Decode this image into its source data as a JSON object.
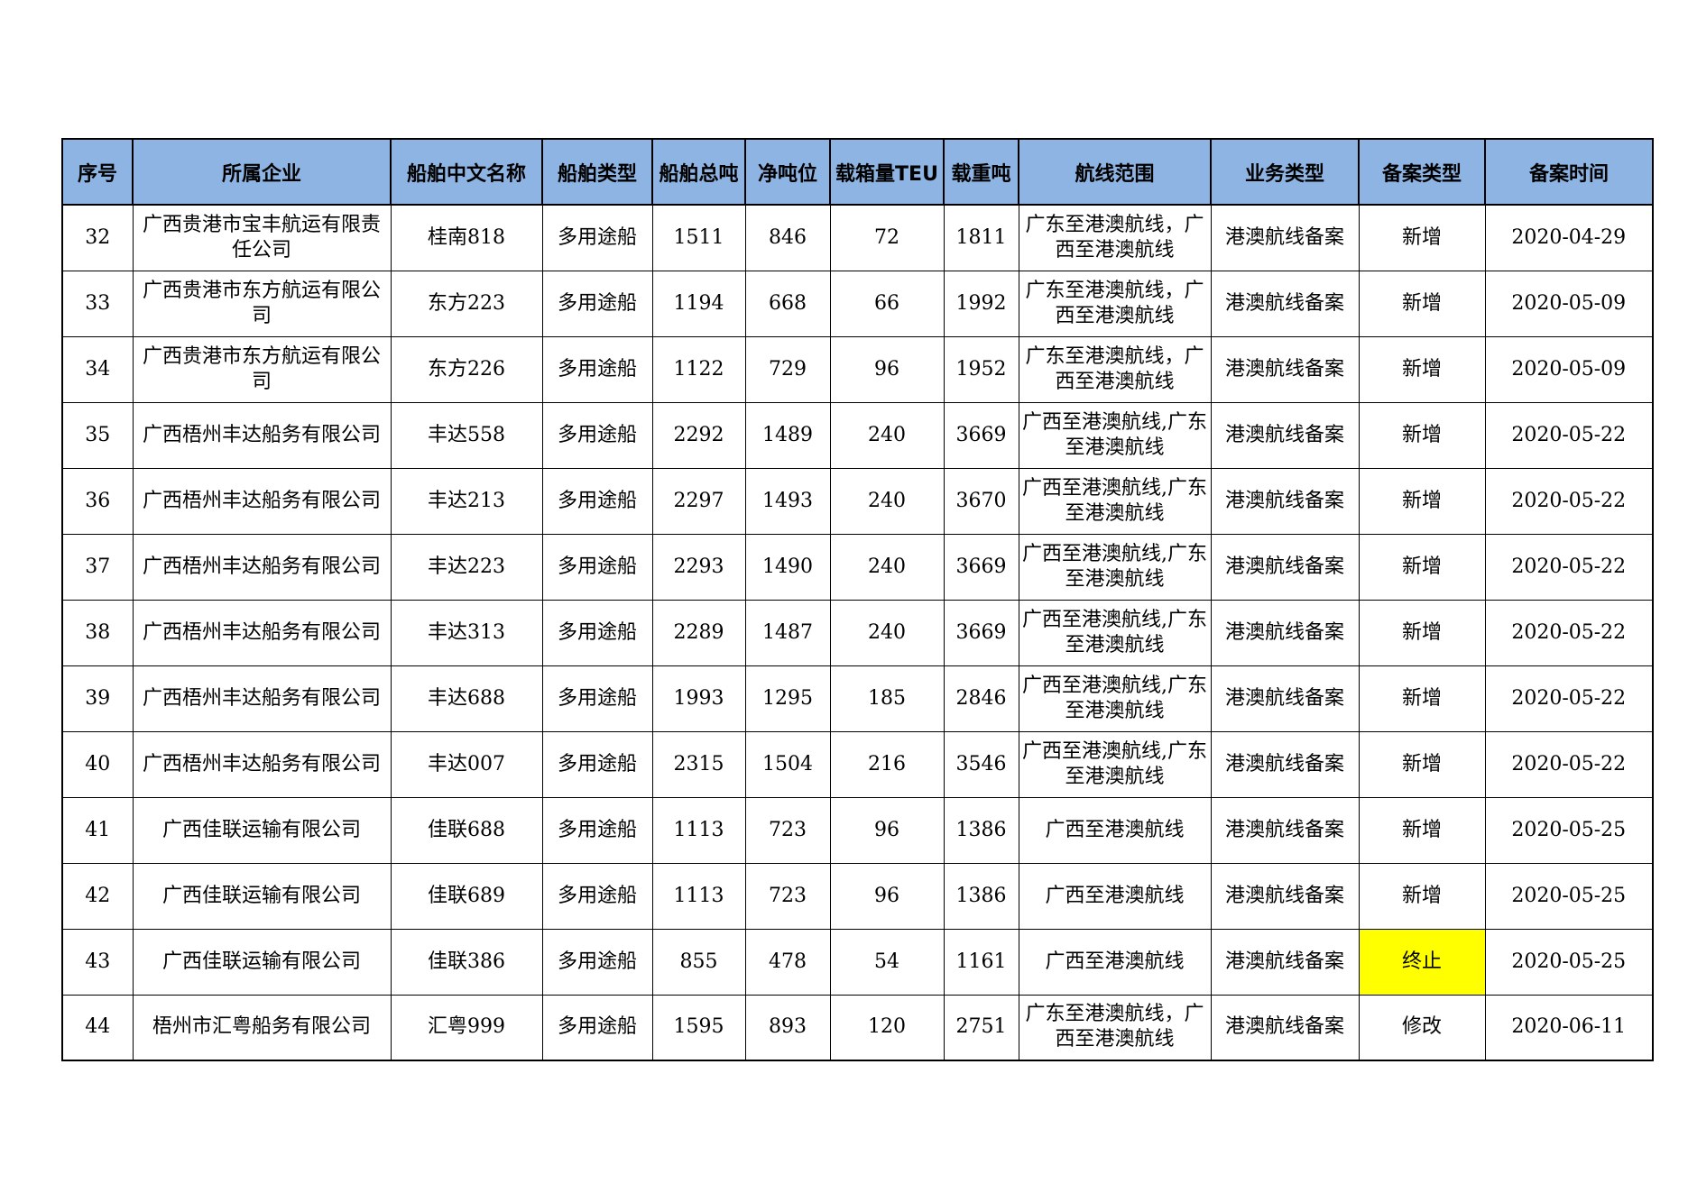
{
  "headers": [
    "序号",
    "所属企业",
    "船舶中文名称",
    "船舶类型",
    "船舶总吨",
    "净吨位",
    "载箱量TEU",
    "载重吨",
    "航线范围",
    "业务类型",
    "备案类型",
    "备案时间"
  ],
  "rows": [
    {
      "no": "32",
      "company": "广西贵港市宝丰航运有限责任公司",
      "ship": "桂南818",
      "type": "多用途船",
      "gross": "1511",
      "net": "846",
      "teu": "72",
      "dwt": "1811",
      "route": "广东至港澳航线，广西至港澳航线",
      "business": "港澳航线备案",
      "record": "新增",
      "date": "2020-04-29"
    },
    {
      "no": "33",
      "company": "广西贵港市东方航运有限公司",
      "ship": "东方223",
      "type": "多用途船",
      "gross": "1194",
      "net": "668",
      "teu": "66",
      "dwt": "1992",
      "route": "广东至港澳航线，广西至港澳航线",
      "business": "港澳航线备案",
      "record": "新增",
      "date": "2020-05-09"
    },
    {
      "no": "34",
      "company": "广西贵港市东方航运有限公司",
      "ship": "东方226",
      "type": "多用途船",
      "gross": "1122",
      "net": "729",
      "teu": "96",
      "dwt": "1952",
      "route": "广东至港澳航线，广西至港澳航线",
      "business": "港澳航线备案",
      "record": "新增",
      "date": "2020-05-09"
    },
    {
      "no": "35",
      "company": "广西梧州丰达船务有限公司",
      "ship": "丰达558",
      "type": "多用途船",
      "gross": "2292",
      "net": "1489",
      "teu": "240",
      "dwt": "3669",
      "route": "广西至港澳航线,广东至港澳航线",
      "business": "港澳航线备案",
      "record": "新增",
      "date": "2020-05-22"
    },
    {
      "no": "36",
      "company": "广西梧州丰达船务有限公司",
      "ship": "丰达213",
      "type": "多用途船",
      "gross": "2297",
      "net": "1493",
      "teu": "240",
      "dwt": "3670",
      "route": "广西至港澳航线,广东至港澳航线",
      "business": "港澳航线备案",
      "record": "新增",
      "date": "2020-05-22"
    },
    {
      "no": "37",
      "company": "广西梧州丰达船务有限公司",
      "ship": "丰达223",
      "type": "多用途船",
      "gross": "2293",
      "net": "1490",
      "teu": "240",
      "dwt": "3669",
      "route": "广西至港澳航线,广东至港澳航线",
      "business": "港澳航线备案",
      "record": "新增",
      "date": "2020-05-22"
    },
    {
      "no": "38",
      "company": "广西梧州丰达船务有限公司",
      "ship": "丰达313",
      "type": "多用途船",
      "gross": "2289",
      "net": "1487",
      "teu": "240",
      "dwt": "3669",
      "route": "广西至港澳航线,广东至港澳航线",
      "business": "港澳航线备案",
      "record": "新增",
      "date": "2020-05-22"
    },
    {
      "no": "39",
      "company": "广西梧州丰达船务有限公司",
      "ship": "丰达688",
      "type": "多用途船",
      "gross": "1993",
      "net": "1295",
      "teu": "185",
      "dwt": "2846",
      "route": "广西至港澳航线,广东至港澳航线",
      "business": "港澳航线备案",
      "record": "新增",
      "date": "2020-05-22"
    },
    {
      "no": "40",
      "company": "广西梧州丰达船务有限公司",
      "ship": "丰达007",
      "type": "多用途船",
      "gross": "2315",
      "net": "1504",
      "teu": "216",
      "dwt": "3546",
      "route": "广西至港澳航线,广东至港澳航线",
      "business": "港澳航线备案",
      "record": "新增",
      "date": "2020-05-22"
    },
    {
      "no": "41",
      "company": "广西佳联运输有限公司",
      "ship": "佳联688",
      "type": "多用途船",
      "gross": "1113",
      "net": "723",
      "teu": "96",
      "dwt": "1386",
      "route": "广西至港澳航线",
      "business": "港澳航线备案",
      "record": "新增",
      "date": "2020-05-25"
    },
    {
      "no": "42",
      "company": "广西佳联运输有限公司",
      "ship": "佳联689",
      "type": "多用途船",
      "gross": "1113",
      "net": "723",
      "teu": "96",
      "dwt": "1386",
      "route": "广西至港澳航线",
      "business": "港澳航线备案",
      "record": "新增",
      "date": "2020-05-25"
    },
    {
      "no": "43",
      "company": "广西佳联运输有限公司",
      "ship": "佳联386",
      "type": "多用途船",
      "gross": "855",
      "net": "478",
      "teu": "54",
      "dwt": "1161",
      "route": "广西至港澳航线",
      "business": "港澳航线备案",
      "record": "终止",
      "date": "2020-05-25",
      "highlight": "#ffff00"
    },
    {
      "no": "44",
      "company": "梧州市汇粤船务有限公司",
      "ship": "汇粤999",
      "type": "多用途船",
      "gross": "1595",
      "net": "893",
      "teu": "120",
      "dwt": "2751",
      "route": "广东至港澳航线，广西至港澳航线",
      "business": "港澳航线备案",
      "record": "修改",
      "date": "2020-06-11"
    }
  ],
  "colors": {
    "header_bg": "#8db4e2",
    "highlight": "#ffff00"
  }
}
